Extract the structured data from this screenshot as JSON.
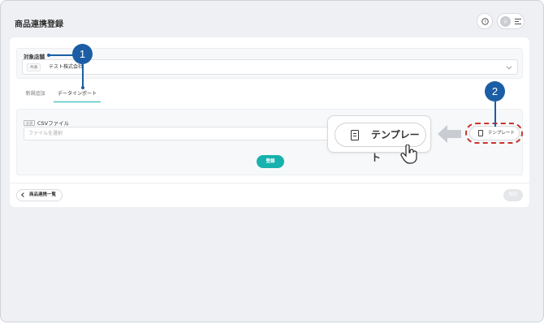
{
  "header": {
    "title": "商品連携登録"
  },
  "avatar_initial": "テ",
  "store": {
    "label": "対象店舗",
    "tag": "共通",
    "name": "テスト株式会社"
  },
  "tabs": [
    {
      "label": "新規追加"
    },
    {
      "label": "データインポート"
    }
  ],
  "upload": {
    "label": "CSVファイル",
    "tag": "必須",
    "placeholder": "ファイルを選択",
    "register_label": "登録",
    "template_label": "テンプレート"
  },
  "footer": {
    "back_label": "商品連携一覧",
    "save_label": "保存"
  },
  "callouts": {
    "one": "1",
    "two": "2",
    "zoom_label": "テンプレート"
  },
  "colors": {
    "accent": "#17b2ad",
    "callout": "#1b5ea5",
    "highlight": "#c8352b"
  }
}
